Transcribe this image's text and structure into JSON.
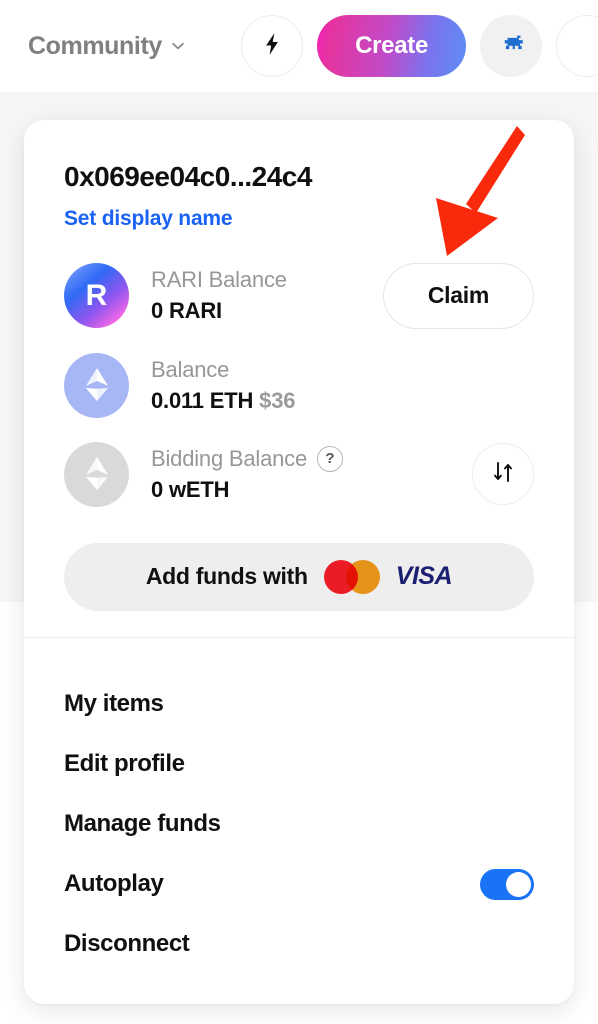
{
  "topbar": {
    "community_label": "Community",
    "chevron_icon": "chevron-down-icon",
    "flash_icon": "lightning-bolt-icon",
    "create_label": "Create",
    "wallet_icon": "pixel-wallet-icon"
  },
  "wallet_card": {
    "address": "0x069ee04c0...24c4",
    "set_display_name": "Set display name",
    "balances": [
      {
        "icon": "rari-token-icon",
        "glyph": "R",
        "label": "RARI Balance",
        "value": "0 RARI",
        "action_label": "Claim"
      },
      {
        "icon": "ethereum-token-icon",
        "label": "Balance",
        "value": "0.011 ETH",
        "fiat": "$36"
      },
      {
        "icon": "wrapped-ethereum-token-icon",
        "label": "Bidding Balance",
        "help": "?",
        "value": "0 wETH",
        "action_icon": "swap-arrows-icon"
      }
    ],
    "add_funds": {
      "label": "Add funds with",
      "mastercard": "mastercard-logo",
      "visa": "VISA"
    },
    "menu": [
      {
        "label": "My items",
        "type": "link"
      },
      {
        "label": "Edit profile",
        "type": "link"
      },
      {
        "label": "Manage funds",
        "type": "link"
      },
      {
        "label": "Autoplay",
        "type": "toggle",
        "toggle_on": true
      },
      {
        "label": "Disconnect",
        "type": "link"
      }
    ]
  },
  "annotation": {
    "arrow_color": "#f92a0c",
    "points_to": "Claim"
  },
  "colors": {
    "accent_blue": "#1a73f5",
    "link_blue": "#1a62f5",
    "create_gradient_start": "#f021b8",
    "create_gradient_end": "#5d8ef6",
    "card_background": "#ffffff",
    "page_panel": "#f6f6f7",
    "muted_text": "#979797",
    "primary_text": "#101010"
  }
}
